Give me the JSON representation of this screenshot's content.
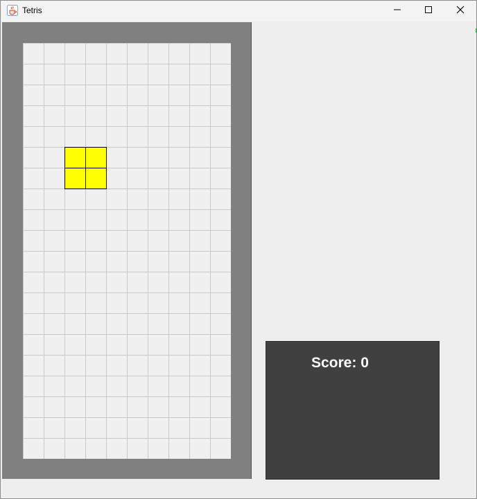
{
  "window": {
    "title": "Tetris",
    "icon": "java-cup-icon",
    "controls": [
      "minimize-icon",
      "maximize-icon",
      "close-icon"
    ]
  },
  "game": {
    "board": {
      "columns": 10,
      "rows": 20
    },
    "active_piece": {
      "shape": "O",
      "color": "#ffff00",
      "cells": [
        [
          2,
          5
        ],
        [
          3,
          5
        ],
        [
          2,
          6
        ],
        [
          3,
          6
        ]
      ]
    },
    "colors": {
      "frame": "#808080",
      "board_background": "#f0f0f0",
      "grid_line": "#c8c8c8",
      "piece_outline": "#000000"
    }
  },
  "score": {
    "label": "Score:",
    "value": "0",
    "panel_color": "#404040"
  }
}
